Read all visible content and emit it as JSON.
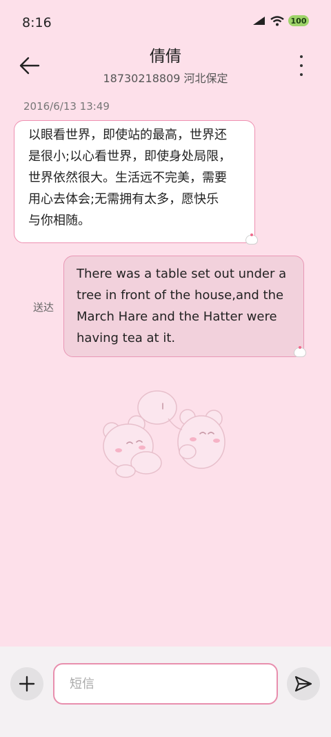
{
  "status_bar": {
    "time": "8:16",
    "battery": "100",
    "icons": [
      "signal-icon",
      "wifi-icon",
      "battery-icon"
    ]
  },
  "header": {
    "contact_name": "倩倩",
    "contact_detail": "18730218809 河北保定",
    "icons": [
      "back-arrow-icon",
      "more-vert-icon"
    ]
  },
  "conversation": {
    "timestamp": "2016/6/13 13:49",
    "incoming": {
      "lines": [
        "以眼看世界，即使站的最高，世界还",
        "是很小;以心看世界，即使身处局限，",
        "世界依然很大。生活远不完美，需要",
        "用心去体会;无需拥有太多，愿快乐",
        "与你相随。"
      ]
    },
    "outgoing": {
      "status": "送达",
      "lines": [
        "There was a table set out under a",
        "tree in front of the house,and the",
        "March Hare and the Hatter were",
        "having tea at it."
      ]
    }
  },
  "composer": {
    "placeholder": "短信",
    "value": "",
    "icons": [
      "plus-icon",
      "send-icon"
    ]
  },
  "colors": {
    "background": "#fde0ea",
    "accent": "#e88ead",
    "outgoing_bubble": "#f2d1dc"
  }
}
